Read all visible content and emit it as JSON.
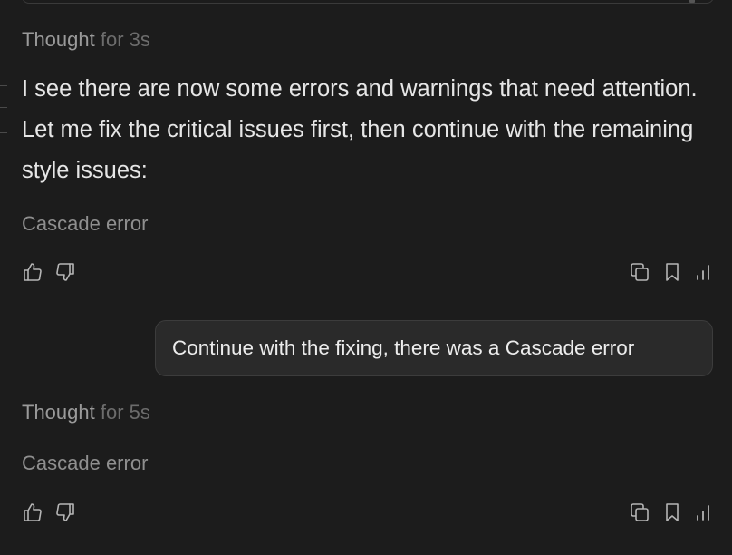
{
  "turn1": {
    "thought_label": "Thought",
    "thought_duration": "for 3s",
    "message": "I see there are now some errors and warnings that need attention. Let me fix the critical issues first, then continue with the remaining style issues:",
    "error_text": "Cascade error",
    "icons": [
      "thumbs-up-icon",
      "thumbs-down-icon",
      "copy-icon",
      "bookmark-icon",
      "stats-icon"
    ]
  },
  "user_message": {
    "text": "Continue with the fixing, there was a Cascade error"
  },
  "turn2": {
    "thought_label": "Thought",
    "thought_duration": "for 5s",
    "error_text": "Cascade error",
    "icons": [
      "thumbs-up-icon",
      "thumbs-down-icon",
      "copy-icon",
      "bookmark-icon",
      "stats-icon"
    ]
  },
  "colors": {
    "background": "#1c1c1c",
    "bubble": "#2a2a2a",
    "muted_text": "#9a9a9a",
    "body_text": "#e6e6e6"
  }
}
